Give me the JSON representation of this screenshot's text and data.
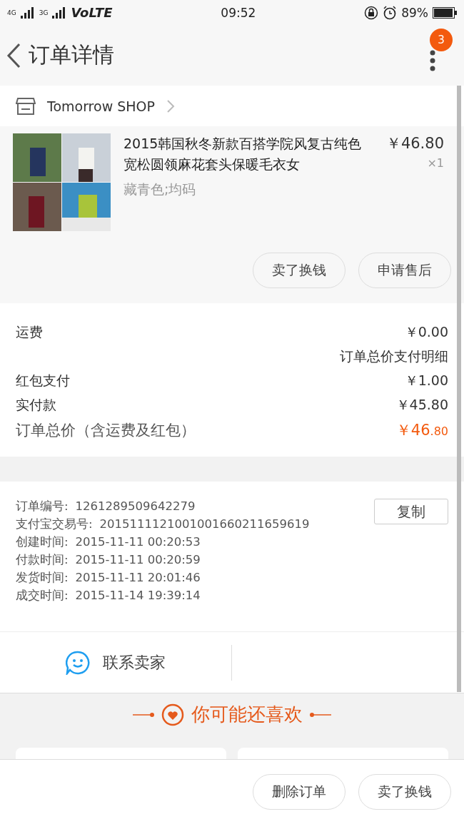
{
  "status_bar": {
    "network_1": "4G",
    "network_2": "3G",
    "carrier": "VoLTE",
    "time": "09:52",
    "battery": "89%"
  },
  "header": {
    "title": "订单详情",
    "badge": "3"
  },
  "shop": {
    "name": "Tomorrow SHOP"
  },
  "product": {
    "kind": "picture",
    "title": "2015韩国秋冬新款百搭学院风复古纯色宽松圆领麻花套头保暖毛衣女",
    "variant": "藏青色;均码",
    "price": "￥46.80",
    "quantity": "×1",
    "buttons": [
      "卖了换钱",
      "申请售后"
    ]
  },
  "fees": [
    {
      "label": "运费",
      "value": "￥0.00"
    },
    {
      "label": "红包支付",
      "value": "￥1.00"
    },
    {
      "label": "实付款",
      "value": "￥45.80"
    }
  ],
  "payment_details": "订单总价支付明细",
  "total": {
    "label": "订单总价（含运费及红包）",
    "integer": "￥46",
    "decimal": ".80"
  },
  "order_info": {
    "copy_button": "复制",
    "rows": [
      {
        "label": "订单编号:",
        "value": "1261289509642279"
      },
      {
        "label": "支付宝交易号:",
        "value": "2015111121001001660211659619"
      },
      {
        "label": "创建时间:",
        "value": "2015-11-11 00:20:53"
      },
      {
        "label": "付款时间:",
        "value": "2015-11-11 00:20:59"
      },
      {
        "label": "发货时间:",
        "value": "2015-11-11 20:01:46"
      },
      {
        "label": "成交时间:",
        "value": "2015-11-14 19:39:14"
      }
    ]
  },
  "contact": {
    "label": "联系卖家"
  },
  "recommend": {
    "title": "你可能还喜欢"
  },
  "bottom_buttons": [
    "删除订单",
    "卖了换钱"
  ]
}
